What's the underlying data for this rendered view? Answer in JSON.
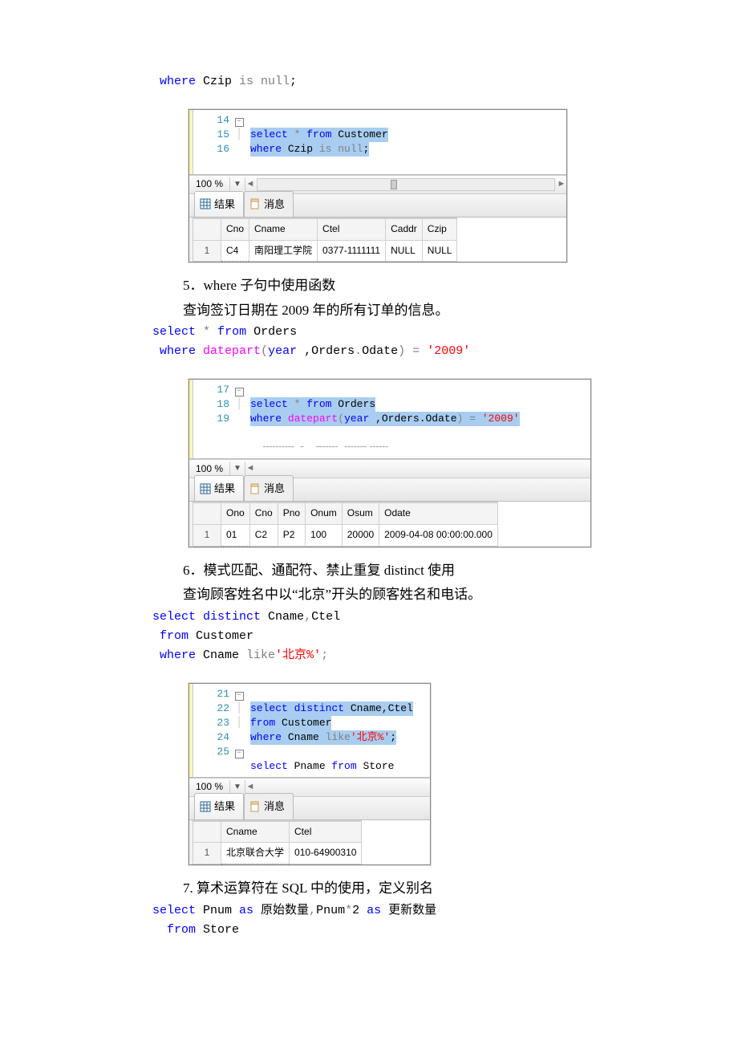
{
  "zoom_label": "100 %",
  "tab_result": "结果",
  "tab_message": "消息",
  "line_where_czip": " where Czip is null;",
  "block4": {
    "editor_lines": [
      "14",
      "15",
      "16"
    ],
    "editor_code": {
      "l14": "select * from Customer",
      "l15": "where Czip is null;"
    },
    "headers": [
      "",
      "Cno",
      "Cname",
      "Ctel",
      "Caddr",
      "Czip"
    ],
    "row": [
      "1",
      "C4",
      "南阳理工学院",
      "0377-1111111",
      "NULL",
      "NULL"
    ]
  },
  "section5_title": "5．where 子句中使用函数",
  "section5_desc": "查询签订日期在 2009 年的所有订单的信息。",
  "section5_code": {
    "l1": "select * from Orders",
    "l2_a": " where ",
    "l2_b": "datepart",
    "l2_c": "(",
    "l2_d": "year",
    "l2_e": " ,Orders.Odate) = ",
    "l2_f": "'2009'"
  },
  "block5": {
    "editor_lines": [
      "17",
      "18",
      "19",
      ""
    ],
    "editor_code": {
      "l17": "select * from Orders",
      "l18a": "where ",
      "l18b": "datepart",
      "l18c": "(",
      "l18d": "year",
      "l18e": " ,Orders.Odate) = ",
      "l18f": "'2009'"
    },
    "headers": [
      "",
      "Ono",
      "Cno",
      "Pno",
      "Onum",
      "Osum",
      "Odate"
    ],
    "row": [
      "1",
      "01",
      "C2",
      "P2",
      "100",
      "20000",
      "2009-04-08 00:00:00.000"
    ]
  },
  "section6_title": "6．模式匹配、通配符、禁止重复 distinct 使用",
  "section6_desc": "查询顾客姓名中以“北京”开头的顾客姓名和电话。",
  "section6_code": {
    "l1": "select distinct Cname,Ctel",
    "l2_a": " from",
    "l2_b": " Customer",
    "l3_a": " where",
    "l3_b": " Cname ",
    "l3_c": "like",
    "l3_d": "'北京%'",
    "l3_e": ";"
  },
  "block6": {
    "editor_lines": [
      "21",
      "22",
      "23",
      "24",
      "25"
    ],
    "editor_code": {
      "l21": "select distinct Cname,Ctel",
      "l22a": "from",
      "l22b": " Customer",
      "l23a": "where",
      "l23b": " Cname ",
      "l23c": "like",
      "l23d": "'北京%'",
      "l23e": ";",
      "l25a": "select",
      "l25b": " Pname ",
      "l25c": "from",
      "l25d": " Store"
    },
    "headers": [
      "",
      "Cname",
      "Ctel"
    ],
    "row": [
      "1",
      "北京联合大学",
      "010-64900310"
    ]
  },
  "section7_title": "7.  算术运算符在 SQL 中的使用，定义别名",
  "section7_code": {
    "l1": "select Pnum as 原始数量,Pnum*2 as 更新数量",
    "l2_a": "  from",
    "l2_b": " Store"
  }
}
